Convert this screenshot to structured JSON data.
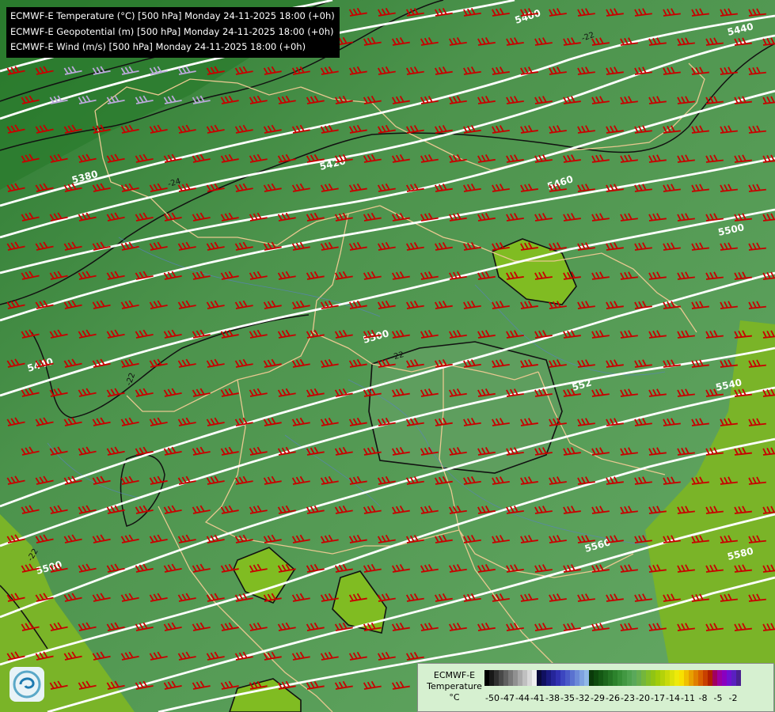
{
  "titles": [
    "ECMWF-E Temperature (°C) [500 hPa] Monday 24-11-2025 18:00 (+0h)",
    "ECMWF-E Geopotential (m) [500 hPa] Monday 24-11-2025 18:00 (+0h)",
    "ECMWF-E Wind (m/s) [500 hPa] Monday 24-11-2025 18:00 (+0h)"
  ],
  "contour_labels": [
    "5400",
    "5440",
    "5380",
    "5420",
    "5460",
    "5500",
    "5440",
    "5500",
    "552",
    "5540",
    "5560",
    "5580",
    "5500",
    "-24",
    "-22",
    "-22",
    "-22",
    "-22"
  ],
  "legend": {
    "line1": "ECMWF-E",
    "line2": "Temperature",
    "line3": "°C",
    "ticks": [
      "-50",
      "-47",
      "-44",
      "-41",
      "-38",
      "-35",
      "-32",
      "-29",
      "-26",
      "-23",
      "-20",
      "-17",
      "-14",
      "-11",
      "-8",
      "-5",
      "-2"
    ],
    "colors": [
      "#000000",
      "#181818",
      "#303030",
      "#484848",
      "#606060",
      "#787878",
      "#909090",
      "#a8a8a8",
      "#c0c0c0",
      "#d8d8d8",
      "#f0f0f0",
      "#0a0a3a",
      "#101060",
      "#1a1a80",
      "#25259a",
      "#3030b0",
      "#3c46c0",
      "#4a5ac8",
      "#5a72d0",
      "#6c8ad8",
      "#7ea2e0",
      "#90b8e8",
      "#0a3a0a",
      "#0e4a0e",
      "#145814",
      "#1c661c",
      "#247424",
      "#2c822c",
      "#368e36",
      "#429842",
      "#4ea24e",
      "#5aa85a",
      "#66ae50",
      "#74b63c",
      "#82be28",
      "#90c414",
      "#a0cc0a",
      "#b4d20a",
      "#c8da0a",
      "#dce20a",
      "#eeea0a",
      "#f8e000",
      "#f0c000",
      "#e8a000",
      "#e08000",
      "#d86000",
      "#c84000",
      "#b02000",
      "#a00060",
      "#9a00a0",
      "#8a00c0",
      "#7010d0",
      "#5a20c0",
      "#4a2090"
    ],
    "color_bounds": [
      -50,
      -2
    ]
  }
}
